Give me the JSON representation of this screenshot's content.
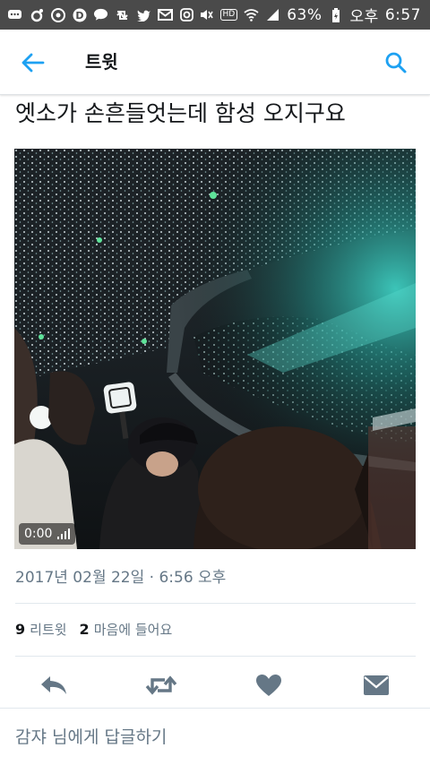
{
  "status_bar": {
    "battery_percent": "63%",
    "ampm": "오후",
    "time": "6:57",
    "hd": "HD",
    "left_icons": [
      "message-icon",
      "o-icon",
      "google-photos-icon",
      "d-app-icon",
      "kakaotalk-icon",
      "retweet-notification-icon",
      "twitter-icon",
      "mail-icon",
      "instagram-icon"
    ],
    "right_icons": [
      "mute-icon",
      "hd-voice-icon",
      "wifi-icon",
      "signal-icon",
      "battery-icon"
    ]
  },
  "appbar": {
    "title": "트윗",
    "back_icon": "arrow-left-icon",
    "search_icon": "search-icon",
    "accent_color": "#1da1f2"
  },
  "tweet": {
    "text": "엣소가 손흔들엇는데 함성 오지구요",
    "media": {
      "kind": "video",
      "duration": "0:00"
    },
    "timestamp": "2017년 02월 22일 · 6:56 오후",
    "retweet_count": "9",
    "retweet_label": "리트윗",
    "like_count": "2",
    "like_label": "마음에 들어요"
  },
  "actions": [
    {
      "name": "reply",
      "icon": "reply-icon"
    },
    {
      "name": "retweet",
      "icon": "retweet-icon"
    },
    {
      "name": "like",
      "icon": "heart-icon"
    },
    {
      "name": "direct-message",
      "icon": "envelope-icon"
    }
  ],
  "reply_box": {
    "placeholder": "감쟈 님에게 답글하기"
  },
  "colors": {
    "status_bar": "#4a4a4a",
    "action_icon": "#657786",
    "secondary_text": "#657786"
  }
}
